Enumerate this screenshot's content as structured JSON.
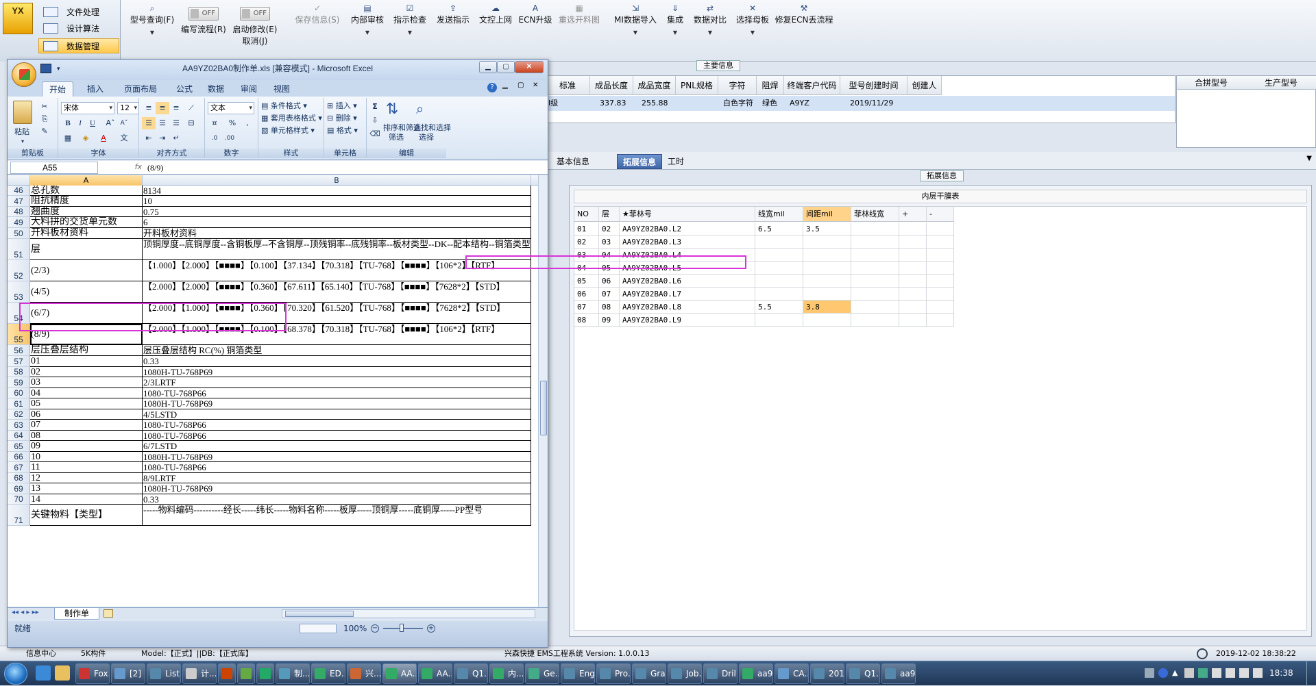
{
  "ems": {
    "logo": "YX",
    "nav": [
      {
        "label": "文件处理"
      },
      {
        "label": "设计算法"
      },
      {
        "label": "数据管理"
      }
    ],
    "ribbon": [
      {
        "label": "型号查询(F)",
        "icon": "search-icon",
        "dd": true
      },
      {
        "label": "编写流程(R)",
        "toggle": "OFF"
      },
      {
        "label": "启动修改(E)",
        "sub": "取消(J)",
        "toggle": "OFF"
      },
      {
        "label": "保存信息(S)",
        "icon": "check-icon",
        "disabled": true
      },
      {
        "label": "内部审核",
        "icon": "print-icon",
        "dd": true
      },
      {
        "label": "指示检查",
        "icon": "checkbox-icon",
        "dd": true
      },
      {
        "label": "发送指示",
        "icon": "upload-icon"
      },
      {
        "label": "文控上网",
        "icon": "cloud-icon"
      },
      {
        "label": "ECN升级",
        "icon": "letter-a-icon"
      },
      {
        "label": "重选开料图",
        "icon": "chart-icon",
        "disabled": true
      },
      {
        "label": "MI数据导入",
        "icon": "import-icon",
        "dd": true
      },
      {
        "label": "集成",
        "icon": "download-icon",
        "dd": true
      },
      {
        "label": "数据对比",
        "icon": "compare-icon",
        "dd": true
      },
      {
        "label": "选择母板",
        "icon": "shuffle-icon",
        "dd": true
      },
      {
        "label": "修复ECN丢流程",
        "icon": "wrench-icon"
      }
    ],
    "main_info_title": "主要信息",
    "info_headers": [
      "标准",
      "成品长度",
      "成品宽度",
      "PNL规格",
      "字符",
      "阻焊",
      "终端客户代码",
      "型号创建时间",
      "创建人"
    ],
    "info_row": [
      "I级",
      "337.83",
      "255.88",
      "",
      "白色字符",
      "绿色",
      "A9YZ",
      "2019/11/29",
      ""
    ],
    "merge_headers": [
      "合拼型号",
      "生产型号"
    ],
    "tabs": [
      "基本信息",
      "拓展信息",
      "工时"
    ],
    "ext_title": "拓展信息",
    "inner_title": "内层干膜表",
    "inner_headers": [
      "NO",
      "层",
      "★菲林号",
      "线宽mil",
      "间距mil",
      "菲林线宽",
      "+",
      "-"
    ],
    "inner_rows": [
      [
        "01",
        "02",
        "AA9YZ02BA0.L2",
        "6.5",
        "3.5",
        ""
      ],
      [
        "02",
        "03",
        "AA9YZ02BA0.L3",
        "",
        "",
        ""
      ],
      [
        "03",
        "04",
        "AA9YZ02BA0.L4",
        "",
        "",
        ""
      ],
      [
        "04",
        "05",
        "AA9YZ02BA0.L5",
        "",
        "",
        ""
      ],
      [
        "05",
        "06",
        "AA9YZ02BA0.L6",
        "",
        "",
        ""
      ],
      [
        "06",
        "07",
        "AA9YZ02BA0.L7",
        "",
        "",
        ""
      ],
      [
        "07",
        "08",
        "AA9YZ02BA0.L8",
        "5.5",
        "3.8",
        ""
      ],
      [
        "08",
        "09",
        "AA9YZ02BA0.L9",
        "",
        "",
        ""
      ]
    ],
    "status": {
      "left1": "信息中心",
      "left2": "5K构件",
      "model": "Model:【正式】||DB:【正式库】",
      "center": "兴森快捷 EMS工程系统 Version: 1.0.0.13",
      "clock": "2019-12-02 18:38:22"
    }
  },
  "excel": {
    "title": "AA9YZ02BA0制作单.xls [兼容模式] - Microsoft Excel",
    "tabs": [
      "开始",
      "插入",
      "页面布局",
      "公式",
      "数据",
      "审阅",
      "视图"
    ],
    "font_name": "宋体",
    "font_size": "12",
    "number_format": "文本",
    "paste_label": "粘贴",
    "groups": [
      "剪贴板",
      "字体",
      "对齐方式",
      "数字",
      "样式",
      "单元格",
      "编辑"
    ],
    "style_buttons": [
      "条件格式",
      "套用表格格式",
      "单元格样式"
    ],
    "cell_buttons": [
      "插入",
      "删除",
      "格式"
    ],
    "edit_buttons": [
      "排序和筛选",
      "查找和选择"
    ],
    "edit_sub": [
      "筛选",
      "选择"
    ],
    "name_box": "A55",
    "formula": "(8/9)",
    "col_a": "A",
    "col_b": "B",
    "rows": [
      {
        "n": "46",
        "a": "总孔数",
        "b": "8134"
      },
      {
        "n": "47",
        "a": "阻抗精度",
        "b": "10"
      },
      {
        "n": "48",
        "a": "翘曲度",
        "b": "0.75"
      },
      {
        "n": "49",
        "a": "大料拼的交货单元数",
        "b": "6"
      },
      {
        "n": "50",
        "a": "开料板材资料",
        "b": "开料板材资料"
      },
      {
        "n": "51",
        "a": "层",
        "b": "顶铜厚度--底铜厚度--含铜板厚--不含铜厚--顶残铜率--底残铜率--板材类型--DK--配本结构--铜箔类型"
      },
      {
        "n": "52",
        "a": "(2/3)",
        "b": "【1.000】【2.000】【■■■■】【0.100】【37.134】【70.318】【TU-768】【■■■■】【106*2】【RTF】"
      },
      {
        "n": "53",
        "a": "(4/5)",
        "b": "【2.000】【2.000】【■■■■】【0.360】【67.611】【65.140】【TU-768】【■■■■】【7628*2】【STD】"
      },
      {
        "n": "54",
        "a": "(6/7)",
        "b": "【2.000】【1.000】【■■■■】【0.360】【70.320】【61.520】【TU-768】【■■■■】【7628*2】【STD】"
      },
      {
        "n": "55",
        "a": "(8/9)",
        "b": "【2.000】【1.000】【■■■■】【0.100】【68.378】【70.318】【TU-768】【■■■■】【106*2】【RTF】"
      },
      {
        "n": "56",
        "a": "层压叠层结构",
        "b": "层压叠层结构   RC(%)   铜箔类型"
      },
      {
        "n": "57",
        "a": "01",
        "b": "0.33"
      },
      {
        "n": "58",
        "a": "02",
        "b": "1080H-TU-768P69"
      },
      {
        "n": "59",
        "a": "03",
        "b": "2/3LRTF"
      },
      {
        "n": "60",
        "a": "04",
        "b": "1080-TU-768P66"
      },
      {
        "n": "61",
        "a": "05",
        "b": "1080H-TU-768P69"
      },
      {
        "n": "62",
        "a": "06",
        "b": "4/5LSTD"
      },
      {
        "n": "63",
        "a": "07",
        "b": "1080-TU-768P66"
      },
      {
        "n": "64",
        "a": "08",
        "b": "1080-TU-768P66"
      },
      {
        "n": "65",
        "a": "09",
        "b": "6/7LSTD"
      },
      {
        "n": "66",
        "a": "10",
        "b": "1080H-TU-768P69"
      },
      {
        "n": "67",
        "a": "11",
        "b": "1080-TU-768P66"
      },
      {
        "n": "68",
        "a": "12",
        "b": "8/9LRTF"
      },
      {
        "n": "69",
        "a": "13",
        "b": "1080H-TU-768P69"
      },
      {
        "n": "70",
        "a": "14",
        "b": "0.33"
      },
      {
        "n": "71",
        "a": "关键物料【类型】",
        "b": "-----物料编码----------经长-----纬长-----物料名称-----板厚-----顶铜厚-----底铜厚-----PP型号"
      }
    ],
    "sheet_tab": "制作单",
    "status_ready": "就绪",
    "zoom": "100%"
  },
  "taskbar": {
    "items": [
      "Fox...",
      "[2] ...",
      "List...",
      "计...",
      "",
      "",
      "",
      "制...",
      "ED...",
      "兴...",
      "AA...",
      "AA...",
      "Q1...",
      "内...",
      "Ge...",
      "Eng...",
      "Pro...",
      "Gra...",
      "Job...",
      "Dril...",
      "aa9...",
      "CA...",
      "201...",
      "Q1...",
      "aa9..."
    ],
    "clock": "18:38"
  }
}
